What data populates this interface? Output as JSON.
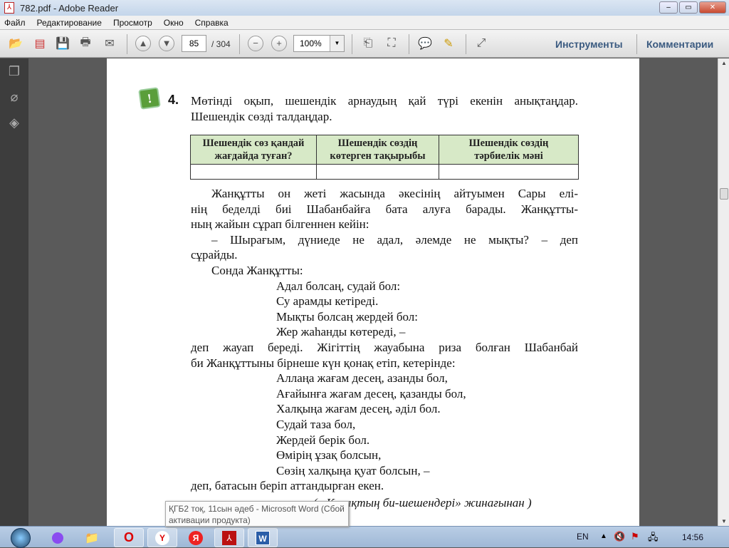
{
  "window": {
    "title": "782.pdf - Adobe Reader",
    "minimize": "‒",
    "maximize": "▭",
    "close": "✕"
  },
  "menu": [
    "Файл",
    "Редактирование",
    "Просмотр",
    "Окно",
    "Справка"
  ],
  "toolbar": {
    "page_current": "85",
    "page_total": "/ 304",
    "zoom": "100%",
    "tools": "Инструменты",
    "comments": "Комментарии"
  },
  "document": {
    "task_number": "4.",
    "task_text": [
      "Мөтінді оқып, шешендік арнаудың қай түрі екенін анықтаңдар.",
      "Шешендік сөзді талдаңдар."
    ],
    "table_headers": [
      [
        "Шешендік сөз қандай",
        "жағдайда туған?"
      ],
      [
        "Шешендік сөздің",
        "көтерген тақырыбы"
      ],
      [
        "Шешендік сөздің",
        "тәрбиелік мәні"
      ]
    ],
    "lines": [
      {
        "t": "Жанқұтты он жеті жасында әкесінің айтуымен Сары елі-",
        "k": "ji"
      },
      {
        "t": "нің беделді биі Шабанбайға бата алуға барады. Жанқұтты-",
        "k": "j"
      },
      {
        "t": "ның жайын сұрап білгеннен кейін:",
        "k": "l"
      },
      {
        "t": "– Шырағым, дүниеде не адал, әлемде не мықты? – деп",
        "k": "ji"
      },
      {
        "t": "сұрайды.",
        "k": "l"
      },
      {
        "t": "Сонда Жанқұтты:",
        "k": "i"
      },
      {
        "t": "Адал болсаң, судай бол:",
        "k": "p"
      },
      {
        "t": "Су арамды кетіреді.",
        "k": "p"
      },
      {
        "t": "Мықты болсаң жердей бол:",
        "k": "p"
      },
      {
        "t": "Жер жаһанды көтереді, –",
        "k": "p"
      },
      {
        "t": "деп жауап береді. Жігіттің жауабына риза болған Шабанбай",
        "k": "j"
      },
      {
        "t": "би Жанқұттыны бірнеше күн қонақ етіп, кетерінде:",
        "k": "l"
      },
      {
        "t": "Аллаңа жағам десең, азанды бол,",
        "k": "p"
      },
      {
        "t": "Ағайынға жағам десең, қазанды бол,",
        "k": "p"
      },
      {
        "t": "Халқыңа жағам десең, әділ бол.",
        "k": "p"
      },
      {
        "t": "Судай таза бол,",
        "k": "p"
      },
      {
        "t": "Жердей берік бол.",
        "k": "p"
      },
      {
        "t": "Өмірің ұзақ болсын,",
        "k": "p"
      },
      {
        "t": "Сөзің халқыңа қуат болсын, –",
        "k": "p"
      },
      {
        "t": "деп, батасын беріп аттандырған екен.",
        "k": "l"
      }
    ],
    "source": "( «Қазақтың би-шешендері» жинағынан )"
  },
  "taskbar": {
    "tooltip": "ҚГБ2 тоқ, 11сын әдеб - Microsoft Word (Сбой активации продукта)",
    "lang": "EN",
    "clock": "14:56"
  }
}
